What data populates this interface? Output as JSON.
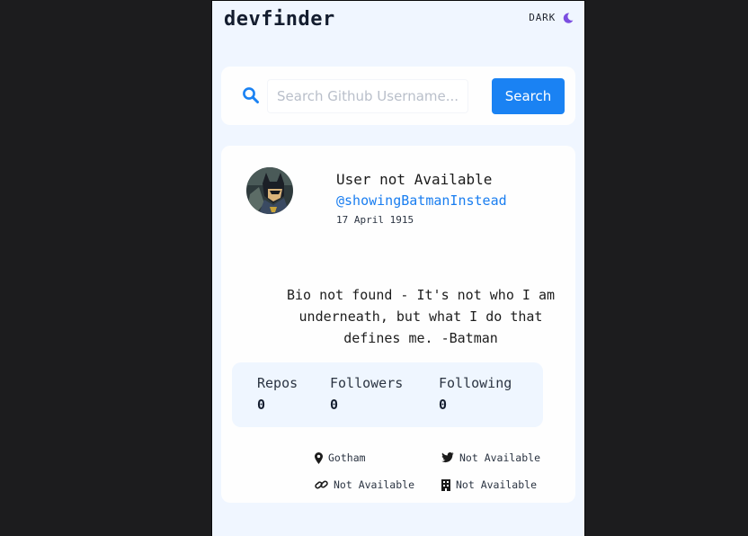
{
  "header": {
    "logo": "devfinder",
    "theme_label": "DARK",
    "theme_icon": "moon-icon"
  },
  "search": {
    "placeholder": "Search Github Username...",
    "value": "",
    "button_label": "Search"
  },
  "profile": {
    "name": "User not Available",
    "handle": "@showingBatmanInstead",
    "joined": "17 April 1915",
    "bio": "Bio not found - It's not who I am underneath, but what I do that defines me. -Batman",
    "stats": [
      {
        "label": "Repos",
        "value": "0"
      },
      {
        "label": "Followers",
        "value": "0"
      },
      {
        "label": "Following",
        "value": "0"
      }
    ],
    "links": {
      "location": "Gotham",
      "twitter": "Not Available",
      "website": "Not Available",
      "company": "Not Available"
    }
  },
  "colors": {
    "accent": "#1a82f3",
    "background": "#f0f6ff",
    "card": "#fefefe",
    "page_backdrop": "#1c1c1e"
  }
}
